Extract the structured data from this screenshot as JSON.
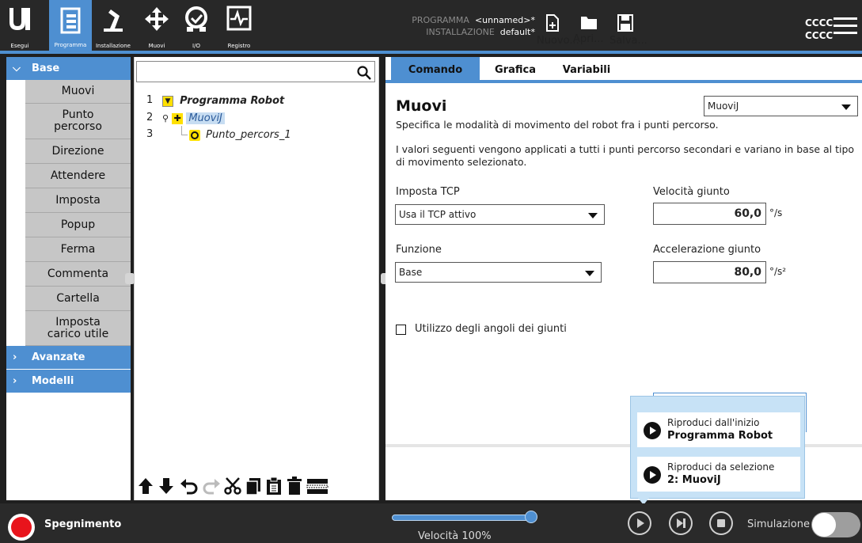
{
  "topbar": {
    "nav": [
      {
        "label": "Esegui",
        "icon": "ur-logo-icon"
      },
      {
        "label": "Programma",
        "icon": "program-tree-icon"
      },
      {
        "label": "Installazione",
        "icon": "robot-arm-icon"
      },
      {
        "label": "Muovi",
        "icon": "move-arrows-icon"
      },
      {
        "label": "I/O",
        "icon": "io-icon"
      },
      {
        "label": "Registro",
        "icon": "log-icon"
      }
    ],
    "program_key": "PROGRAMMA",
    "program_value": "<unnamed>*",
    "install_key": "INSTALLAZIONE",
    "install_value": "default*",
    "file_buttons": [
      {
        "label": "Nuovo...",
        "icon": "new-file-icon"
      },
      {
        "label": "Apri...",
        "icon": "folder-icon"
      },
      {
        "label": "Salva...",
        "icon": "save-icon"
      }
    ],
    "user_line1": "CCCC",
    "user_line2": "CCCC"
  },
  "sidebar": {
    "base_label": "Base",
    "items": [
      "Muovi",
      "Punto percorso",
      "Direzione",
      "Attendere",
      "Imposta",
      "Popup",
      "Ferma",
      "Commenta",
      "Cartella",
      "Imposta carico utile"
    ],
    "advanced_label": "Avanzate",
    "templates_label": "Modelli"
  },
  "tree": {
    "rows": [
      {
        "num": "1",
        "text": "Programma Robot"
      },
      {
        "num": "2",
        "text": "MuoviJ"
      },
      {
        "num": "3",
        "text": "Punto_percors_1"
      }
    ]
  },
  "tabs": [
    "Comando",
    "Grafica",
    "Variabili"
  ],
  "command": {
    "title": "Muovi",
    "move_type": "MuoviJ",
    "description": "Specifica le modalità di movimento del robot fra i punti percorso.",
    "info": "I valori seguenti vengono applicati a tutti i punti percorso secondari e variano in base al tipo di movimento selezionato.",
    "tcp_label": "Imposta TCP",
    "tcp_value": "Usa il TCP attivo",
    "feature_label": "Funzione",
    "feature_value": "Base",
    "joint_speed_label": "Velocità giunto",
    "joint_speed_value": "60,0",
    "joint_speed_unit": "°/s",
    "joint_accel_label": "Accelerazione giunto",
    "joint_accel_value": "80,0",
    "joint_accel_unit": "°/s²",
    "joint_angles_checkbox": "Utilizzo degli angoli dei giunti"
  },
  "popup": {
    "play_start_line1": "Riproduci dall'inizio",
    "play_start_line2": "Programma Robot",
    "play_sel_line1": "Riproduci da selezione",
    "play_sel_line2": "2: MuoviJ"
  },
  "bottombar": {
    "power_label": "Spegnimento",
    "speed_label": "Velocità 100%",
    "speed_value": 1.0,
    "sim_label": "Simulazione"
  },
  "colors": {
    "accent": "#4e8fd1",
    "topbar": "#282828",
    "power": "#e8141c"
  }
}
